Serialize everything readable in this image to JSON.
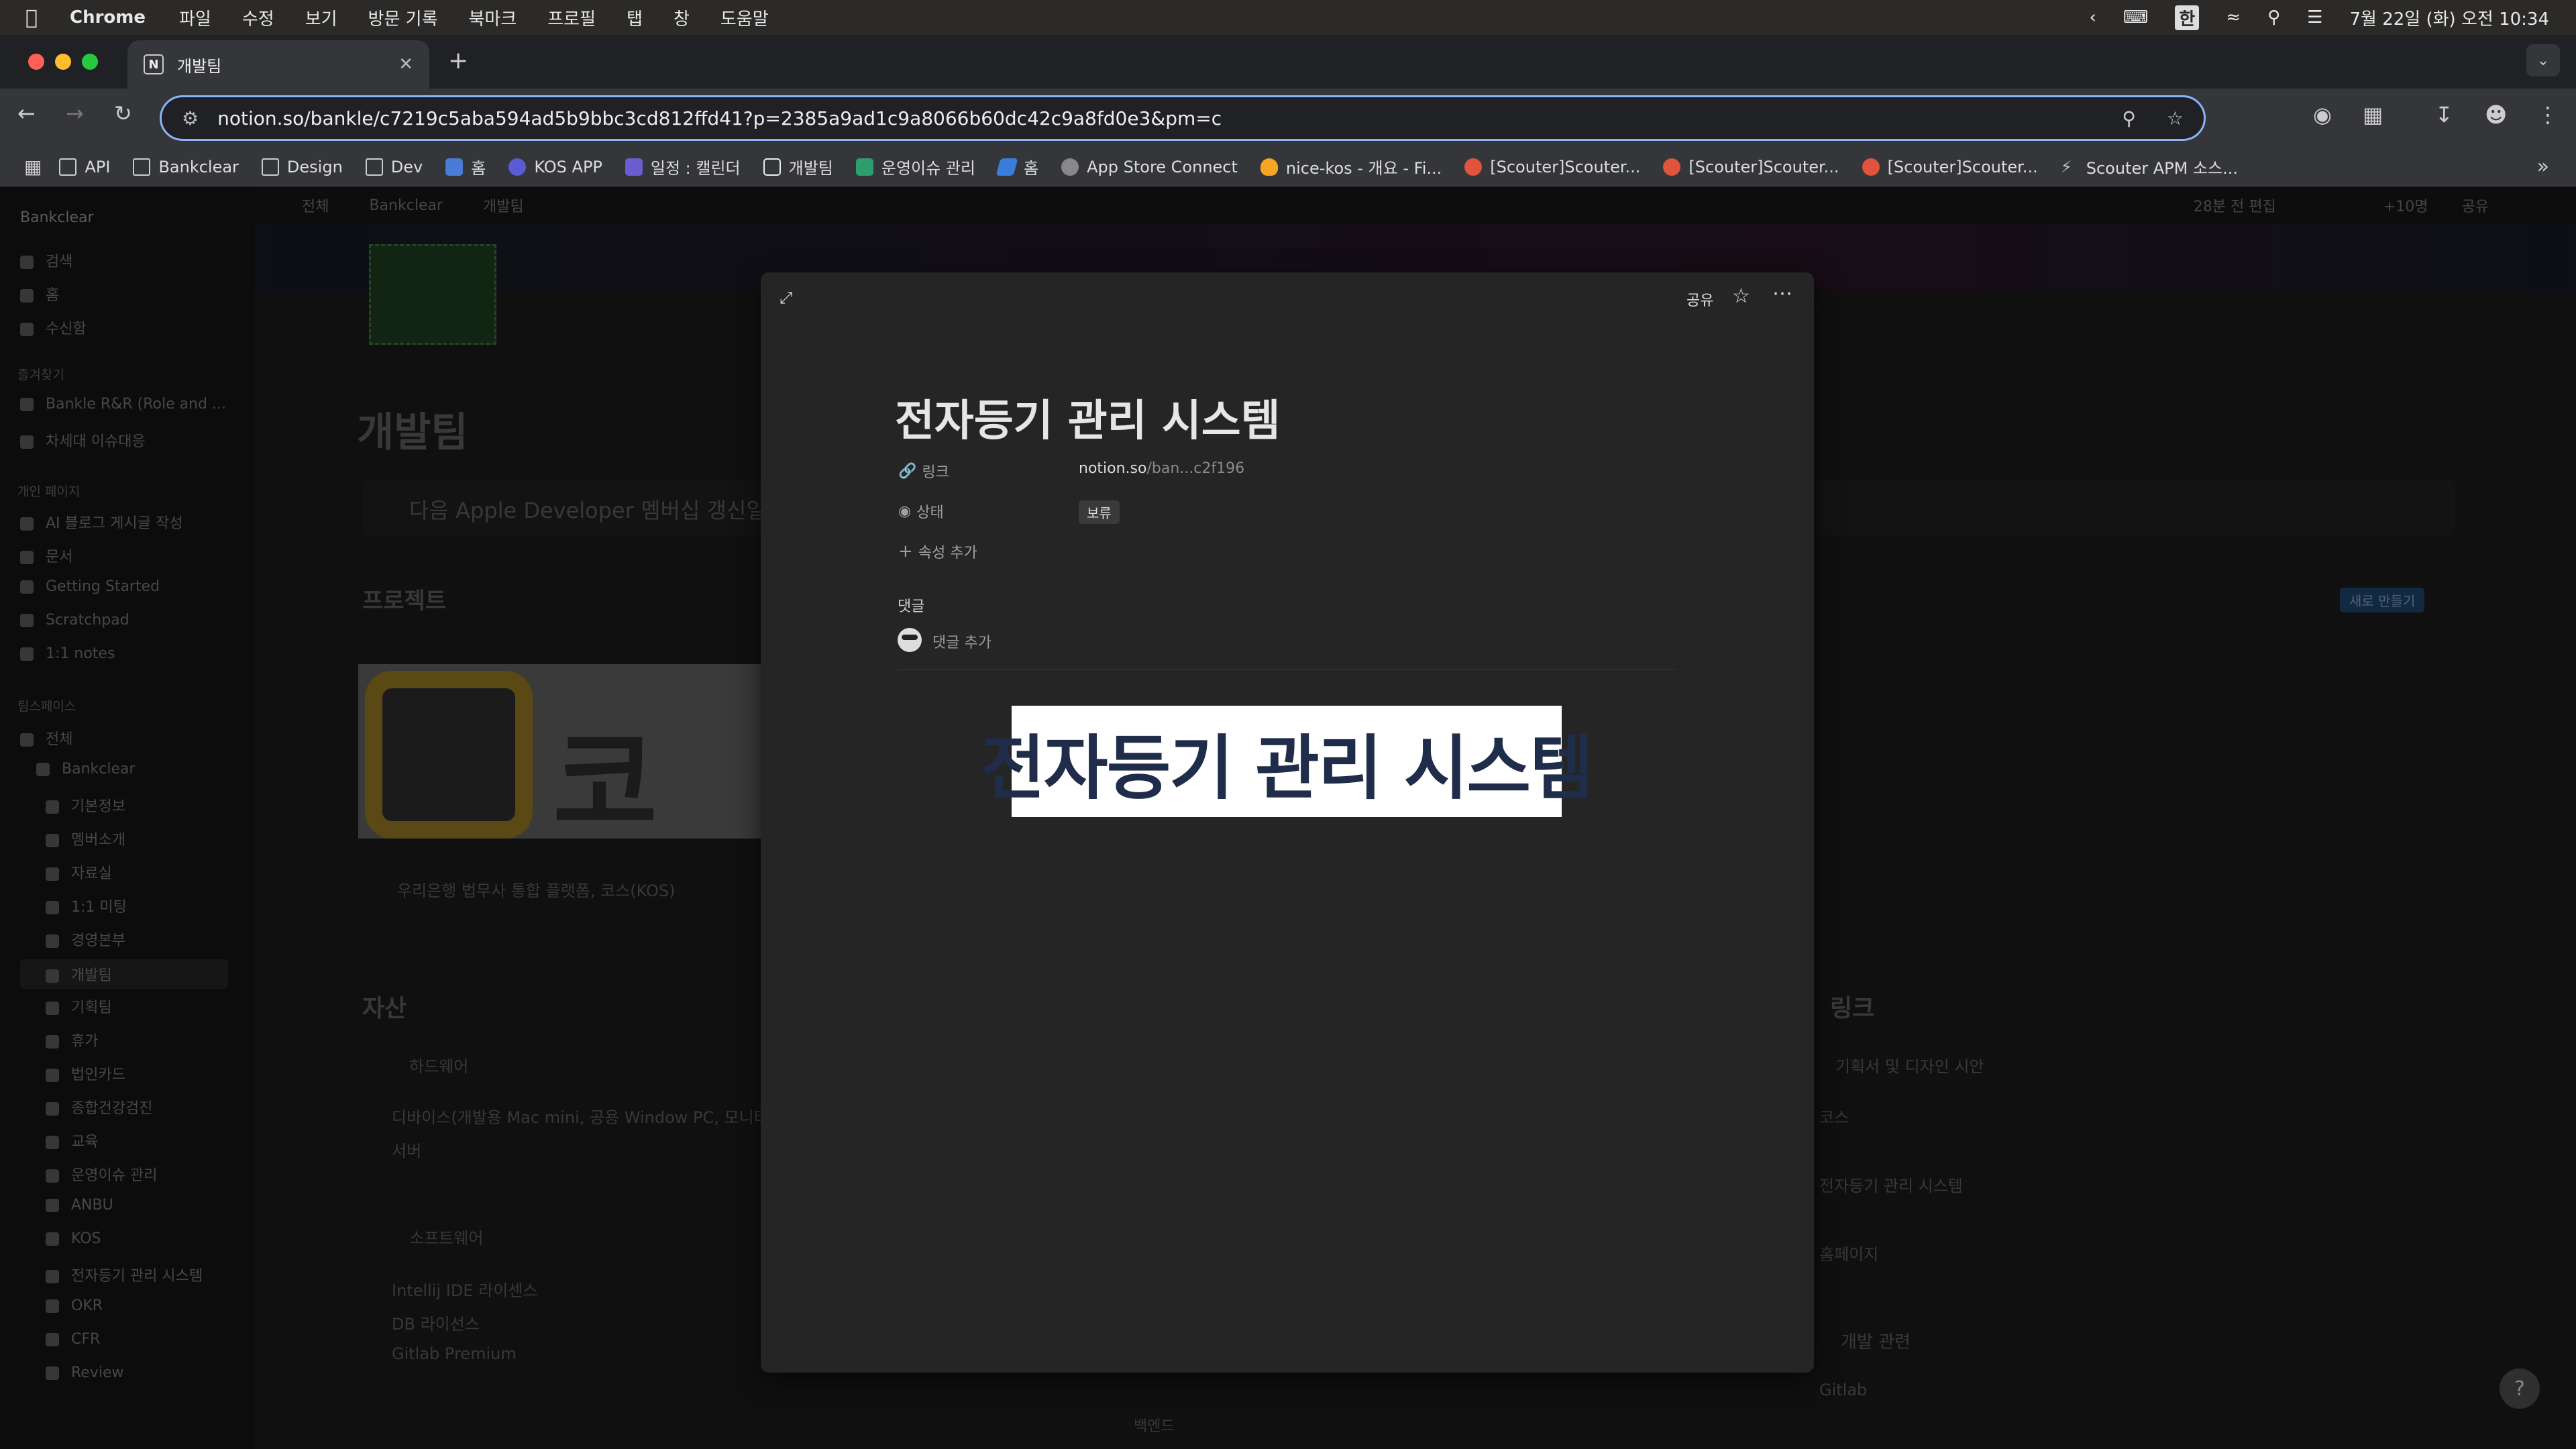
{
  "menubar": {
    "app": "Chrome",
    "items": [
      "파일",
      "수정",
      "보기",
      "방문 기록",
      "북마크",
      "프로필",
      "탭",
      "창",
      "도움말"
    ],
    "ime": "한",
    "datetime": "7월 22일 (화) 오전 10:34"
  },
  "tab": {
    "title": "개발팀"
  },
  "omnibox": {
    "url": "notion.so/bankle/c7219c5aba594ad5b9bbc3cd812ffd41?p=2385a9ad1c9a8066b60dc42c9a8fd0e3&pm=c"
  },
  "bookmarks": [
    {
      "label": "API",
      "icon": "folder-icon",
      "color": "#cccccc"
    },
    {
      "label": "Bankclear",
      "icon": "folder-icon",
      "color": "#cccccc"
    },
    {
      "label": "Design",
      "icon": "folder-icon",
      "color": "#cccccc"
    },
    {
      "label": "Dev",
      "icon": "folder-icon",
      "color": "#cccccc"
    },
    {
      "label": "홈",
      "icon": "app-icon",
      "color": "#4a7bd6"
    },
    {
      "label": "KOS APP",
      "icon": "app-icon",
      "color": "#5b5bd6"
    },
    {
      "label": "일정 : 캘린더",
      "icon": "calendar-icon",
      "color": "#6d5bd0"
    },
    {
      "label": "개발팀",
      "icon": "notion-icon",
      "color": "#eeeeee"
    },
    {
      "label": "운영이슈 관리",
      "icon": "app-icon",
      "color": "#2f9e6e"
    },
    {
      "label": "홈",
      "icon": "jira-icon",
      "color": "#3b7ddd"
    },
    {
      "label": "App Store Connect",
      "icon": "apple-icon",
      "color": "#aaaaaa"
    },
    {
      "label": "nice-kos - 개요 - Fi...",
      "icon": "firebase-icon",
      "color": "#f5a623"
    },
    {
      "label": "[Scouter]Scouter...",
      "icon": "scouter-icon",
      "color": "#e0533d"
    },
    {
      "label": "[Scouter]Scouter...",
      "icon": "scouter-icon",
      "color": "#e0533d"
    },
    {
      "label": "[Scouter]Scouter...",
      "icon": "scouter-icon",
      "color": "#e0533d"
    },
    {
      "label": "Scouter APM 소스...",
      "icon": "bolt-icon",
      "color": "#aaaaaa"
    }
  ],
  "sidebar": {
    "workspace": "Bankclear",
    "items": [
      "검색",
      "홈",
      "수신함"
    ],
    "favorites_title": "즐겨찾기",
    "favorites": [
      "Bankle R&R (Role and ...",
      "차세대 이슈대응"
    ],
    "private_title": "개인 페이지",
    "private": [
      "AI 블로그 게시글 작성",
      "문서",
      "Getting Started",
      "Scratchpad",
      "1:1 notes"
    ],
    "teamspace_title": "팀스페이스",
    "teamspace": [
      "전체",
      "Bankclear",
      "기본정보",
      "멤버소개",
      "자료실",
      "1:1 미팅",
      "경영본부",
      "개발팀",
      "기획팀",
      "휴가",
      "법인카드",
      "종합건강검진",
      "교육",
      "운영이슈 관리",
      "ANBU",
      "KOS",
      "전자등기 관리 시스템",
      "OKR",
      "CFR",
      "Review"
    ]
  },
  "background": {
    "breadcrumb": [
      "전체",
      "Bankclear",
      "개발팀"
    ],
    "page_title": "개발팀",
    "callout": "다음 Apple Developer 멤버십 갱신일은",
    "projects_title": "프로젝트",
    "new_button": "새로 만들기",
    "project_caption": "우리은행 법무사 통합 플랫폼, 코스(KOS)",
    "project_logo_text": "코스",
    "assets_title": "자산",
    "hardware": "하드웨어",
    "hardware_items": [
      "디바이스(개발용 Mac mini, 공용 Window PC, 모니터",
      "서버"
    ],
    "software": "소프트웨어",
    "software_items": [
      "Intellij IDE 라이센스",
      "DB 라이선스",
      "Gitlab Premium"
    ],
    "links_title": "링크",
    "links": [
      "기획서 및 디자인 시안",
      "코스",
      "전자등기 관리 시스템",
      "홈페이지"
    ],
    "dev_related": "개발 관련",
    "gitlab": "Gitlab",
    "backend": "백엔드",
    "share": "공유",
    "edited": "28분 전 편집",
    "people": "+10명"
  },
  "modal": {
    "share_label": "공유",
    "title": "전자등기 관리 시스템",
    "link_label": "링크",
    "link_value_main": "notion.so",
    "link_value_rest": "/ban...c2f196",
    "status_label": "상태",
    "status_value": "보류",
    "add_property": "속성 추가",
    "comments_title": "댓글",
    "add_comment": "댓글 추가",
    "image_text": "전자등기 관리 시스템"
  }
}
